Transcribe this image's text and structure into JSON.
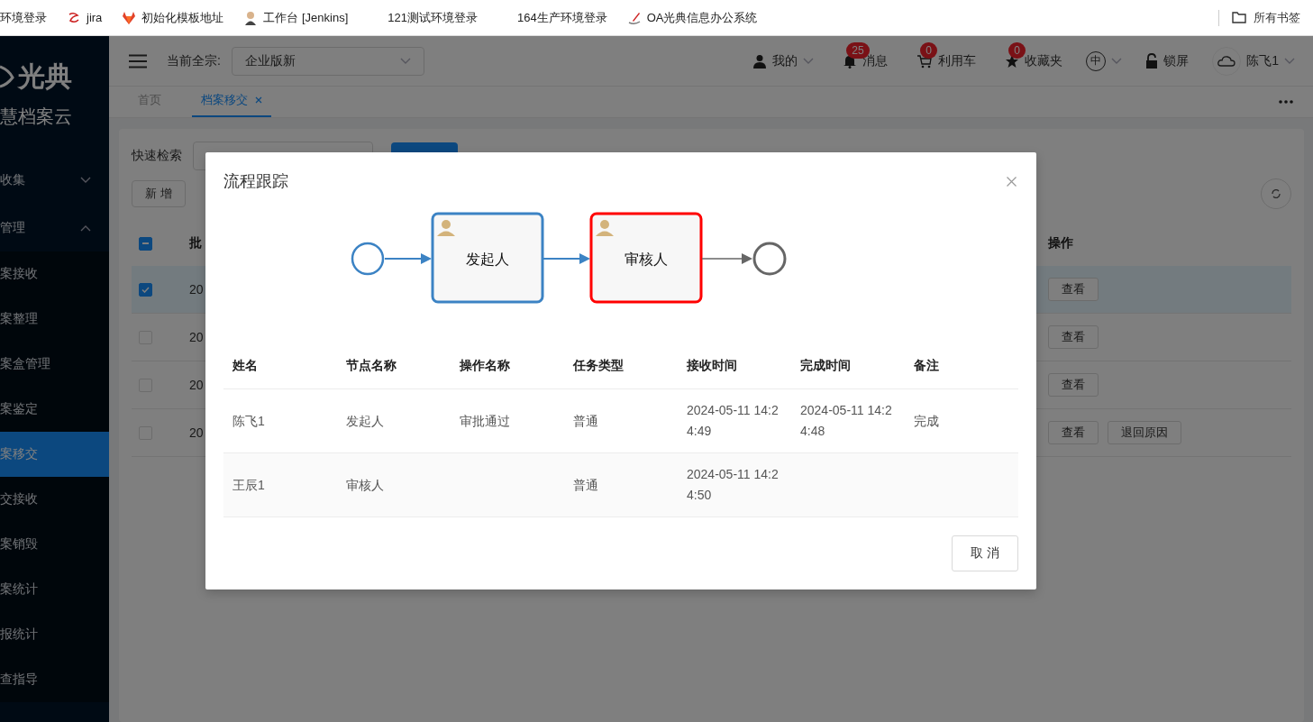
{
  "bookmarks": [
    {
      "label": "环境登录",
      "kind": "plain"
    },
    {
      "label": "jira",
      "kind": "swirl"
    },
    {
      "label": "初始化模板地址",
      "kind": "fox"
    },
    {
      "label": "工作台 [Jenkins]",
      "kind": "figure"
    },
    {
      "label": "121测试环境登录",
      "kind": "blank"
    },
    {
      "label": "164生产环境登录",
      "kind": "blank"
    },
    {
      "label": "OA光典信息办公系统",
      "kind": "pen"
    }
  ],
  "all_bookmarks": "所有书签",
  "sidebar": {
    "logo": "光典",
    "subtitle": "慧档案云",
    "items": [
      {
        "label": "收集",
        "kind": "group",
        "expanded": false,
        "selected": false
      },
      {
        "label": "管理",
        "kind": "group",
        "expanded": true,
        "selected": false
      },
      {
        "label": "案接收",
        "kind": "sub",
        "selected": false
      },
      {
        "label": "案整理",
        "kind": "sub",
        "selected": false
      },
      {
        "label": "案盒管理",
        "kind": "sub",
        "selected": false
      },
      {
        "label": "案鉴定",
        "kind": "sub",
        "selected": false
      },
      {
        "label": "案移交",
        "kind": "sub",
        "selected": true
      },
      {
        "label": "交接收",
        "kind": "sub",
        "selected": false
      },
      {
        "label": "案销毁",
        "kind": "sub",
        "selected": false
      },
      {
        "label": "案统计",
        "kind": "sub",
        "selected": false
      },
      {
        "label": "报统计",
        "kind": "sub",
        "selected": false
      },
      {
        "label": "查指导",
        "kind": "sub",
        "selected": false
      }
    ]
  },
  "header": {
    "fonds_label": "当前全宗:",
    "fonds_value": "企业版新",
    "items": [
      {
        "label": "我的",
        "kind": "user"
      },
      {
        "label": "消息",
        "kind": "bell",
        "badge": "25"
      },
      {
        "label": "利用车",
        "kind": "cart",
        "badge": "0"
      },
      {
        "label": "收藏夹",
        "kind": "star",
        "badge": "0"
      }
    ],
    "language": "中",
    "lock": "锁屏",
    "user": "陈飞1"
  },
  "tabs": [
    {
      "label": "首页",
      "selected": false,
      "closable": false
    },
    {
      "label": "档案移交",
      "selected": true,
      "closable": true
    }
  ],
  "toolbar": {
    "search_label": "快速检索",
    "add_button": "新 增"
  },
  "table": {
    "header_indeterminate": true,
    "columns": [
      "批",
      "操作"
    ],
    "rows": [
      {
        "selected": true,
        "column_1": "20",
        "actions": [
          "查看"
        ]
      },
      {
        "selected": false,
        "column_1": "20",
        "actions": [
          "查看"
        ]
      },
      {
        "selected": false,
        "column_1": "20",
        "actions": [
          "查看"
        ]
      },
      {
        "selected": false,
        "column_1": "20",
        "actions": [
          "查看",
          "退回原因"
        ]
      }
    ]
  },
  "dialog": {
    "title": "流程跟踪",
    "flow": [
      {
        "kind": "start",
        "color": "#3c83c4"
      },
      {
        "kind": "task",
        "label": "发起人",
        "color": "#3c83c4"
      },
      {
        "kind": "task",
        "label": "审核人",
        "color": "#ff0000"
      },
      {
        "kind": "end",
        "color": "#666666"
      }
    ],
    "edges": [
      {
        "color": "#3c83c4"
      },
      {
        "color": "#3c83c4"
      },
      {
        "color": "#666666"
      }
    ],
    "columns": [
      "姓名",
      "节点名称",
      "操作名称",
      "任务类型",
      "接收时间",
      "完成时间",
      "备注"
    ],
    "rows": [
      [
        "陈飞1",
        "发起人",
        "审批通过",
        "普通",
        "2024-05-11 14:24:49",
        "2024-05-11 14:24:48",
        "完成"
      ],
      [
        "王辰1",
        "审核人",
        "",
        "普通",
        "2024-05-11 14:24:50",
        "",
        ""
      ]
    ],
    "cancel": "取 消"
  }
}
